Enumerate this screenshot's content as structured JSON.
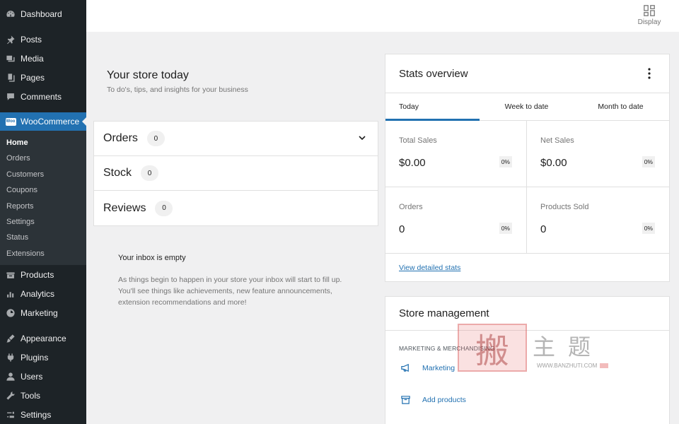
{
  "sidebar": {
    "top_items": [
      {
        "label": "Dashboard",
        "icon": "dashboard-icon"
      },
      {
        "label": "Posts",
        "icon": "pin-icon"
      },
      {
        "label": "Media",
        "icon": "media-icon"
      },
      {
        "label": "Pages",
        "icon": "pages-icon"
      },
      {
        "label": "Comments",
        "icon": "comments-icon"
      }
    ],
    "woocommerce": {
      "label": "WooCommerce",
      "badge": "Woo"
    },
    "submenu": [
      "Home",
      "Orders",
      "Customers",
      "Coupons",
      "Reports",
      "Settings",
      "Status",
      "Extensions"
    ],
    "bottom_items": [
      {
        "label": "Products",
        "icon": "products-icon"
      },
      {
        "label": "Analytics",
        "icon": "analytics-icon"
      },
      {
        "label": "Marketing",
        "icon": "megaphone-icon"
      },
      {
        "label": "Appearance",
        "icon": "brush-icon"
      },
      {
        "label": "Plugins",
        "icon": "plugin-icon"
      },
      {
        "label": "Users",
        "icon": "users-icon"
      },
      {
        "label": "Tools",
        "icon": "wrench-icon"
      },
      {
        "label": "Settings",
        "icon": "settings-icon"
      }
    ]
  },
  "header": {
    "display_label": "Display"
  },
  "store_today": {
    "title": "Your store today",
    "subtitle": "To do's, tips, and insights for your business"
  },
  "tasks": [
    {
      "label": "Orders",
      "count": "0"
    },
    {
      "label": "Stock",
      "count": "0"
    },
    {
      "label": "Reviews",
      "count": "0"
    }
  ],
  "inbox": {
    "title": "Your inbox is empty",
    "message": "As things begin to happen in your store your inbox will start to fill up. You'll see things like achievements, new feature announcements, extension recommendations and more!"
  },
  "stats": {
    "title": "Stats overview",
    "tabs": [
      "Today",
      "Week to date",
      "Month to date"
    ],
    "cells": [
      {
        "label": "Total Sales",
        "value": "$0.00",
        "pct": "0%"
      },
      {
        "label": "Net Sales",
        "value": "$0.00",
        "pct": "0%"
      },
      {
        "label": "Orders",
        "value": "0",
        "pct": "0%"
      },
      {
        "label": "Products Sold",
        "value": "0",
        "pct": "0%"
      }
    ],
    "link": "View detailed stats"
  },
  "store_management": {
    "title": "Store management",
    "section": "MARKETING & MERCHANDISING",
    "items": [
      "Marketing",
      "Add products"
    ]
  },
  "watermark": {
    "stamp": "搬",
    "brand": "主题",
    "url": "WWW.BANZHUTI.COM"
  },
  "colors": {
    "accent": "#2271b1",
    "sidebar_bg": "#1d2327",
    "sub_bg": "#2c3338"
  }
}
